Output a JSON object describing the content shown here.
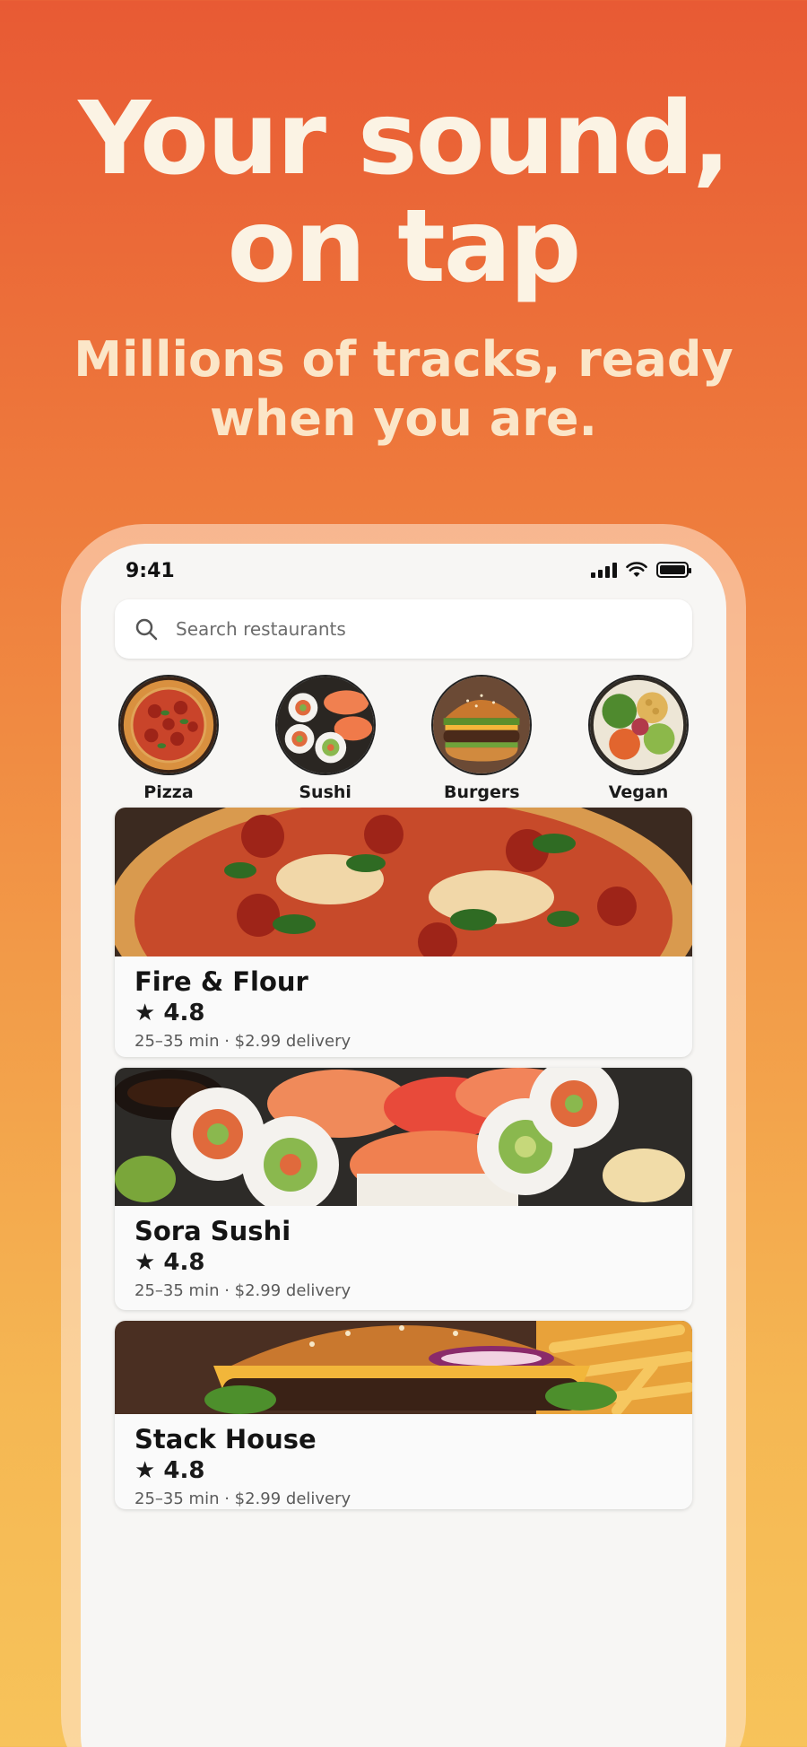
{
  "hero": {
    "title_line1": "Your sound,",
    "title_line2": "on tap",
    "subtitle_line1": "Millions of tracks, ready",
    "subtitle_line2": "when you are."
  },
  "status_bar": {
    "time": "9:41"
  },
  "search": {
    "placeholder": "Search restaurants",
    "value": ""
  },
  "categories": [
    {
      "label": "Pizza",
      "icon": "pizza-image"
    },
    {
      "label": "Sushi",
      "icon": "sushi-image"
    },
    {
      "label": "Burgers",
      "icon": "burger-image"
    },
    {
      "label": "Vegan",
      "icon": "vegan-bowl-image"
    }
  ],
  "restaurants": [
    {
      "name": "Fire & Flour",
      "rating": "★ 4.8",
      "meta": "25–35 min · $2.99 delivery"
    },
    {
      "name": "Sora Sushi",
      "rating": "★ 4.8",
      "meta": "25–35 min · $2.99 delivery"
    },
    {
      "name": "Stack House",
      "rating": "★ 4.8",
      "meta": "25–35 min · $2.99 delivery"
    }
  ],
  "colors": {
    "background_top": "#e85a34",
    "background_bottom": "#f7c35a",
    "hero_text": "#fbf3e4"
  }
}
